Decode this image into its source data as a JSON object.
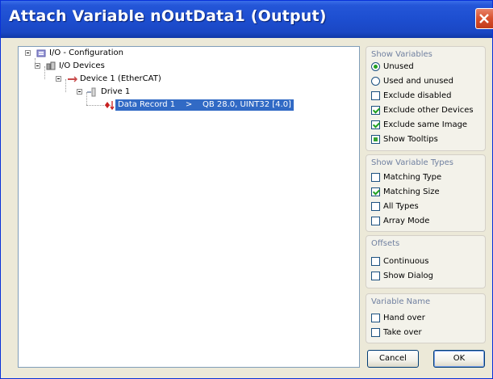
{
  "window": {
    "title": "Attach Variable nOutData1 (Output)"
  },
  "tree": {
    "io_configuration": "I/O - Configuration",
    "io_devices": "I/O Devices",
    "device1": "Device 1 (EtherCAT)",
    "drive1": "Drive 1",
    "data_record": "Data Record 1    >    QB 28.0, UINT32 [4.0]"
  },
  "show_variables": {
    "title": "Show Variables",
    "options": [
      {
        "label": "Unused",
        "type": "radio",
        "checked": true
      },
      {
        "label": "Used and unused",
        "type": "radio",
        "checked": false
      },
      {
        "label": "Exclude disabled",
        "type": "checkbox",
        "checked": false
      },
      {
        "label": "Exclude other Devices",
        "type": "checkbox",
        "checked": true
      },
      {
        "label": "Exclude same Image",
        "type": "checkbox",
        "checked": true
      },
      {
        "label": "Show Tooltips",
        "type": "checkbox",
        "checked": "indeterminate"
      }
    ]
  },
  "show_variable_types": {
    "title": "Show Variable Types",
    "options": [
      {
        "label": "Matching Type",
        "checked": false
      },
      {
        "label": "Matching Size",
        "checked": true
      },
      {
        "label": "All Types",
        "checked": false
      },
      {
        "label": "Array Mode",
        "checked": false
      }
    ]
  },
  "offsets": {
    "title": "Offsets",
    "options": [
      {
        "label": "Continuous",
        "checked": false
      },
      {
        "label": "Show Dialog",
        "checked": false
      }
    ]
  },
  "variable_name": {
    "title": "Variable Name",
    "options": [
      {
        "label": "Hand over",
        "checked": false
      },
      {
        "label": "Take over",
        "checked": false
      }
    ]
  },
  "buttons": {
    "cancel": "Cancel",
    "ok": "OK"
  },
  "colors": {
    "titlebar": "#1d4ed0",
    "selection": "#316ac5",
    "check": "#21a121"
  }
}
